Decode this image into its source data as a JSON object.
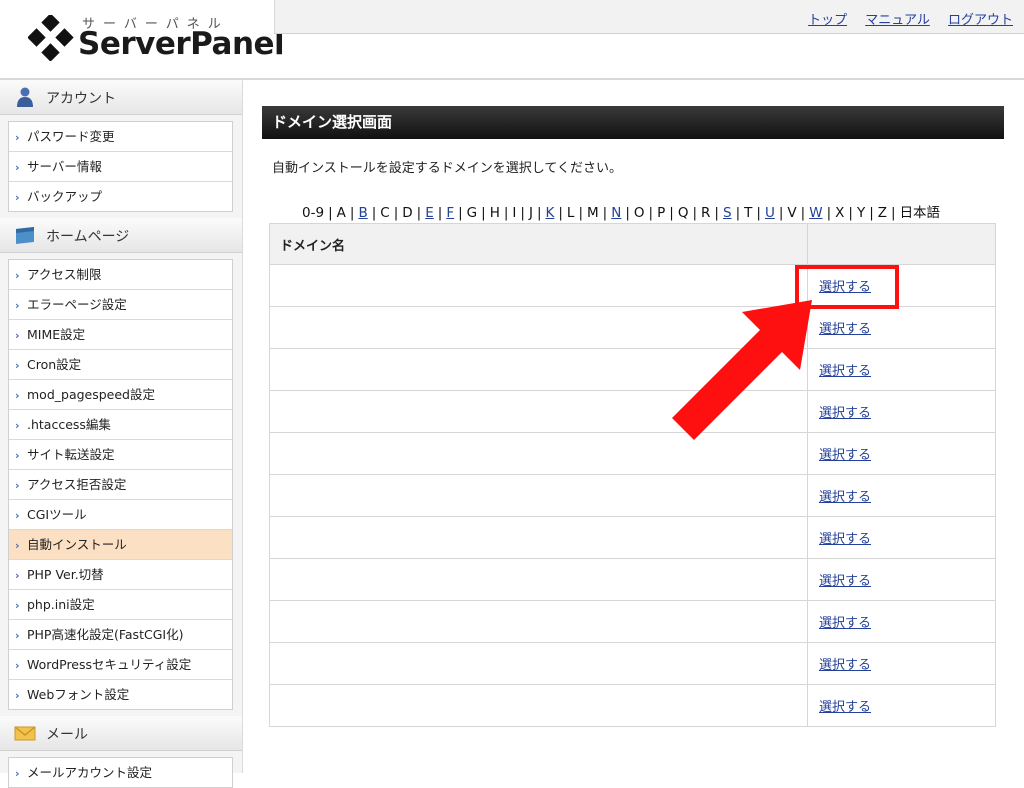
{
  "header": {
    "logo_sub": "サーバーパネル",
    "logo_main": "ServerPanel",
    "links": [
      "トップ",
      "マニュアル",
      "ログアウト"
    ]
  },
  "sidebar": {
    "sections": [
      {
        "title": "アカウント",
        "icon": "person-icon",
        "items": [
          "パスワード変更",
          "サーバー情報",
          "バックアップ"
        ]
      },
      {
        "title": "ホームページ",
        "icon": "folder-icon",
        "items": [
          "アクセス制限",
          "エラーページ設定",
          "MIME設定",
          "Cron設定",
          "mod_pagespeed設定",
          ".htaccess編集",
          "サイト転送設定",
          "アクセス拒否設定",
          "CGIツール",
          "自動インストール",
          "PHP Ver.切替",
          "php.ini設定",
          "PHP高速化設定(FastCGI化)",
          "WordPressセキュリティ設定",
          "Webフォント設定"
        ]
      },
      {
        "title": "メール",
        "icon": "mail-icon",
        "items": [
          "メールアカウント設定"
        ]
      }
    ],
    "active_item": "自動インストール"
  },
  "main": {
    "title": "ドメイン選択画面",
    "instruction": "自動インストールを設定するドメインを選択してください。",
    "alpha_nav": [
      {
        "label": "0-9",
        "link": false
      },
      {
        "label": "A",
        "link": false
      },
      {
        "label": "B",
        "link": true
      },
      {
        "label": "C",
        "link": false
      },
      {
        "label": "D",
        "link": false
      },
      {
        "label": "E",
        "link": true
      },
      {
        "label": "F",
        "link": true
      },
      {
        "label": "G",
        "link": false
      },
      {
        "label": "H",
        "link": false
      },
      {
        "label": "I",
        "link": false
      },
      {
        "label": "J",
        "link": false
      },
      {
        "label": "K",
        "link": true
      },
      {
        "label": "L",
        "link": false
      },
      {
        "label": "M",
        "link": false
      },
      {
        "label": "N",
        "link": true
      },
      {
        "label": "O",
        "link": false
      },
      {
        "label": "P",
        "link": false
      },
      {
        "label": "Q",
        "link": false
      },
      {
        "label": "R",
        "link": false
      },
      {
        "label": "S",
        "link": true
      },
      {
        "label": "T",
        "link": false
      },
      {
        "label": "U",
        "link": true
      },
      {
        "label": "V",
        "link": false
      },
      {
        "label": "W",
        "link": true
      },
      {
        "label": "X",
        "link": false
      },
      {
        "label": "Y",
        "link": false
      },
      {
        "label": "Z",
        "link": false
      },
      {
        "label": "日本語",
        "link": false
      }
    ],
    "table": {
      "header": "ドメイン名",
      "rows": [
        {
          "domain": "",
          "action": "選択する"
        },
        {
          "domain": "",
          "action": "選択する"
        },
        {
          "domain": "",
          "action": "選択する"
        },
        {
          "domain": "",
          "action": "選択する"
        },
        {
          "domain": "",
          "action": "選択する"
        },
        {
          "domain": "",
          "action": "選択する"
        },
        {
          "domain": "",
          "action": "選択する"
        },
        {
          "domain": "",
          "action": "選択する"
        },
        {
          "domain": "",
          "action": "選択する"
        },
        {
          "domain": "",
          "action": "選択する"
        },
        {
          "domain": "",
          "action": "選択する"
        }
      ]
    }
  },
  "annotation": {
    "color": "#ff1010"
  }
}
